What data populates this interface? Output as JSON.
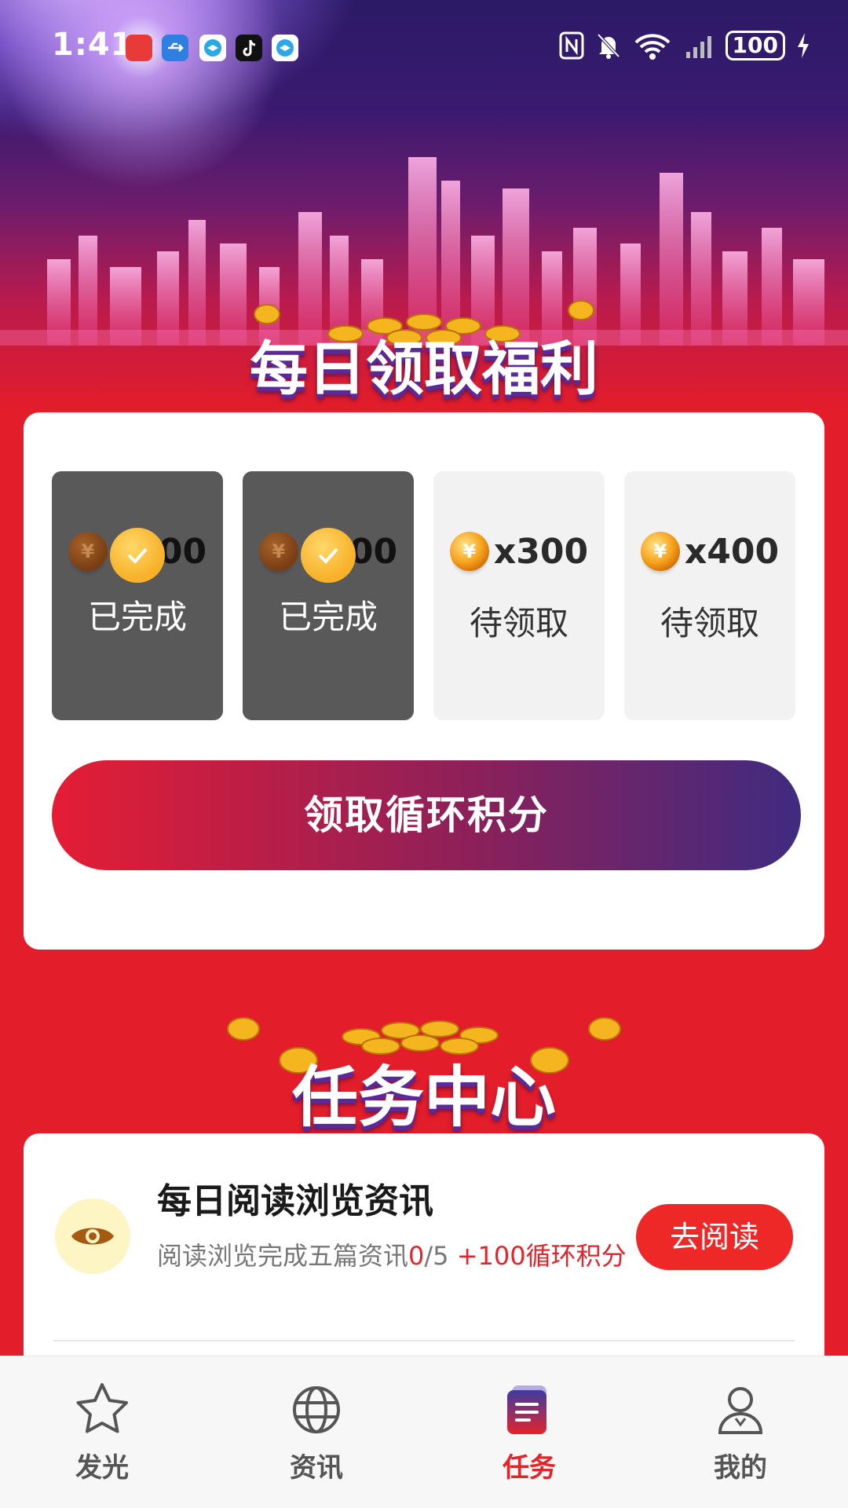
{
  "status_bar": {
    "time": "1:41",
    "battery": "100",
    "app_icons": [
      "huawei-appgallery-icon",
      "usb-icon",
      "browser-icon",
      "tiktok-icon",
      "browser-icon"
    ]
  },
  "daily": {
    "title": "每日领取福利",
    "slots": [
      {
        "amount": "x100",
        "status": "已完成",
        "state": "done"
      },
      {
        "amount": "x200",
        "status": "已完成",
        "state": "done"
      },
      {
        "amount": "x300",
        "status": "待领取",
        "state": "pending"
      },
      {
        "amount": "x400",
        "status": "待领取",
        "state": "pending"
      }
    ],
    "claim_button": "领取循环积分"
  },
  "tasks": {
    "title": "任务中心",
    "items": [
      {
        "title": "每日阅读浏览资讯",
        "desc_prefix": "阅读浏览完成五篇资讯",
        "progress_done": "0",
        "progress_total": "/5",
        "reward": " +100循环积分",
        "button": "去阅读"
      }
    ]
  },
  "nav": {
    "items": [
      {
        "label": "发光",
        "icon": "star-icon"
      },
      {
        "label": "资讯",
        "icon": "globe-icon"
      },
      {
        "label": "任务",
        "icon": "task-list-icon"
      },
      {
        "label": "我的",
        "icon": "profile-icon"
      }
    ],
    "active_index": 2
  },
  "colors": {
    "accent_red": "#e3242b",
    "page_red": "#e31d2a",
    "gradient_end": "#3f2b80"
  }
}
